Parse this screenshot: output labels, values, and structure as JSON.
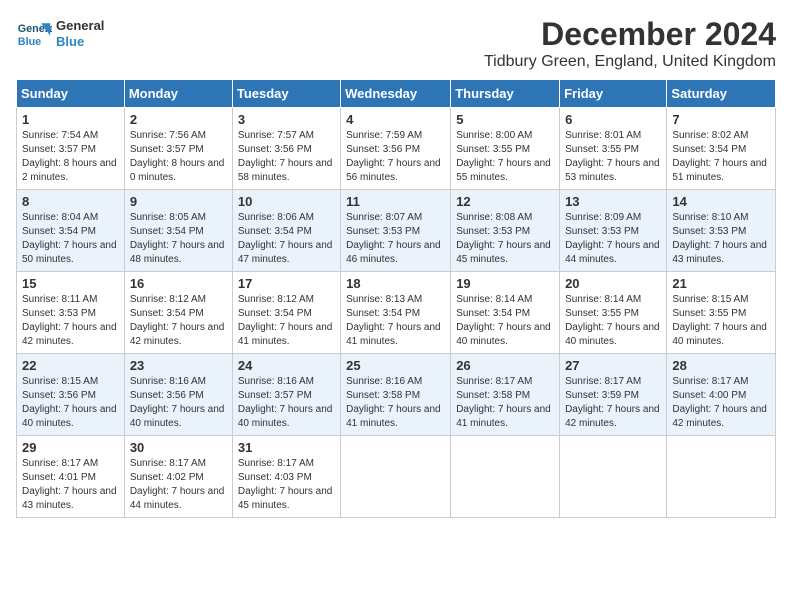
{
  "logo": {
    "line1": "General",
    "line2": "Blue"
  },
  "title": "December 2024",
  "location": "Tidbury Green, England, United Kingdom",
  "days_header": [
    "Sunday",
    "Monday",
    "Tuesday",
    "Wednesday",
    "Thursday",
    "Friday",
    "Saturday"
  ],
  "weeks": [
    [
      {
        "day": "1",
        "sunrise": "7:54 AM",
        "sunset": "3:57 PM",
        "daylight": "8 hours and 2 minutes."
      },
      {
        "day": "2",
        "sunrise": "7:56 AM",
        "sunset": "3:57 PM",
        "daylight": "8 hours and 0 minutes."
      },
      {
        "day": "3",
        "sunrise": "7:57 AM",
        "sunset": "3:56 PM",
        "daylight": "7 hours and 58 minutes."
      },
      {
        "day": "4",
        "sunrise": "7:59 AM",
        "sunset": "3:56 PM",
        "daylight": "7 hours and 56 minutes."
      },
      {
        "day": "5",
        "sunrise": "8:00 AM",
        "sunset": "3:55 PM",
        "daylight": "7 hours and 55 minutes."
      },
      {
        "day": "6",
        "sunrise": "8:01 AM",
        "sunset": "3:55 PM",
        "daylight": "7 hours and 53 minutes."
      },
      {
        "day": "7",
        "sunrise": "8:02 AM",
        "sunset": "3:54 PM",
        "daylight": "7 hours and 51 minutes."
      }
    ],
    [
      {
        "day": "8",
        "sunrise": "8:04 AM",
        "sunset": "3:54 PM",
        "daylight": "7 hours and 50 minutes."
      },
      {
        "day": "9",
        "sunrise": "8:05 AM",
        "sunset": "3:54 PM",
        "daylight": "7 hours and 48 minutes."
      },
      {
        "day": "10",
        "sunrise": "8:06 AM",
        "sunset": "3:54 PM",
        "daylight": "7 hours and 47 minutes."
      },
      {
        "day": "11",
        "sunrise": "8:07 AM",
        "sunset": "3:53 PM",
        "daylight": "7 hours and 46 minutes."
      },
      {
        "day": "12",
        "sunrise": "8:08 AM",
        "sunset": "3:53 PM",
        "daylight": "7 hours and 45 minutes."
      },
      {
        "day": "13",
        "sunrise": "8:09 AM",
        "sunset": "3:53 PM",
        "daylight": "7 hours and 44 minutes."
      },
      {
        "day": "14",
        "sunrise": "8:10 AM",
        "sunset": "3:53 PM",
        "daylight": "7 hours and 43 minutes."
      }
    ],
    [
      {
        "day": "15",
        "sunrise": "8:11 AM",
        "sunset": "3:53 PM",
        "daylight": "7 hours and 42 minutes."
      },
      {
        "day": "16",
        "sunrise": "8:12 AM",
        "sunset": "3:54 PM",
        "daylight": "7 hours and 42 minutes."
      },
      {
        "day": "17",
        "sunrise": "8:12 AM",
        "sunset": "3:54 PM",
        "daylight": "7 hours and 41 minutes."
      },
      {
        "day": "18",
        "sunrise": "8:13 AM",
        "sunset": "3:54 PM",
        "daylight": "7 hours and 41 minutes."
      },
      {
        "day": "19",
        "sunrise": "8:14 AM",
        "sunset": "3:54 PM",
        "daylight": "7 hours and 40 minutes."
      },
      {
        "day": "20",
        "sunrise": "8:14 AM",
        "sunset": "3:55 PM",
        "daylight": "7 hours and 40 minutes."
      },
      {
        "day": "21",
        "sunrise": "8:15 AM",
        "sunset": "3:55 PM",
        "daylight": "7 hours and 40 minutes."
      }
    ],
    [
      {
        "day": "22",
        "sunrise": "8:15 AM",
        "sunset": "3:56 PM",
        "daylight": "7 hours and 40 minutes."
      },
      {
        "day": "23",
        "sunrise": "8:16 AM",
        "sunset": "3:56 PM",
        "daylight": "7 hours and 40 minutes."
      },
      {
        "day": "24",
        "sunrise": "8:16 AM",
        "sunset": "3:57 PM",
        "daylight": "7 hours and 40 minutes."
      },
      {
        "day": "25",
        "sunrise": "8:16 AM",
        "sunset": "3:58 PM",
        "daylight": "7 hours and 41 minutes."
      },
      {
        "day": "26",
        "sunrise": "8:17 AM",
        "sunset": "3:58 PM",
        "daylight": "7 hours and 41 minutes."
      },
      {
        "day": "27",
        "sunrise": "8:17 AM",
        "sunset": "3:59 PM",
        "daylight": "7 hours and 42 minutes."
      },
      {
        "day": "28",
        "sunrise": "8:17 AM",
        "sunset": "4:00 PM",
        "daylight": "7 hours and 42 minutes."
      }
    ],
    [
      {
        "day": "29",
        "sunrise": "8:17 AM",
        "sunset": "4:01 PM",
        "daylight": "7 hours and 43 minutes."
      },
      {
        "day": "30",
        "sunrise": "8:17 AM",
        "sunset": "4:02 PM",
        "daylight": "7 hours and 44 minutes."
      },
      {
        "day": "31",
        "sunrise": "8:17 AM",
        "sunset": "4:03 PM",
        "daylight": "7 hours and 45 minutes."
      },
      null,
      null,
      null,
      null
    ]
  ],
  "labels": {
    "sunrise": "Sunrise:",
    "sunset": "Sunset:",
    "daylight": "Daylight:"
  }
}
